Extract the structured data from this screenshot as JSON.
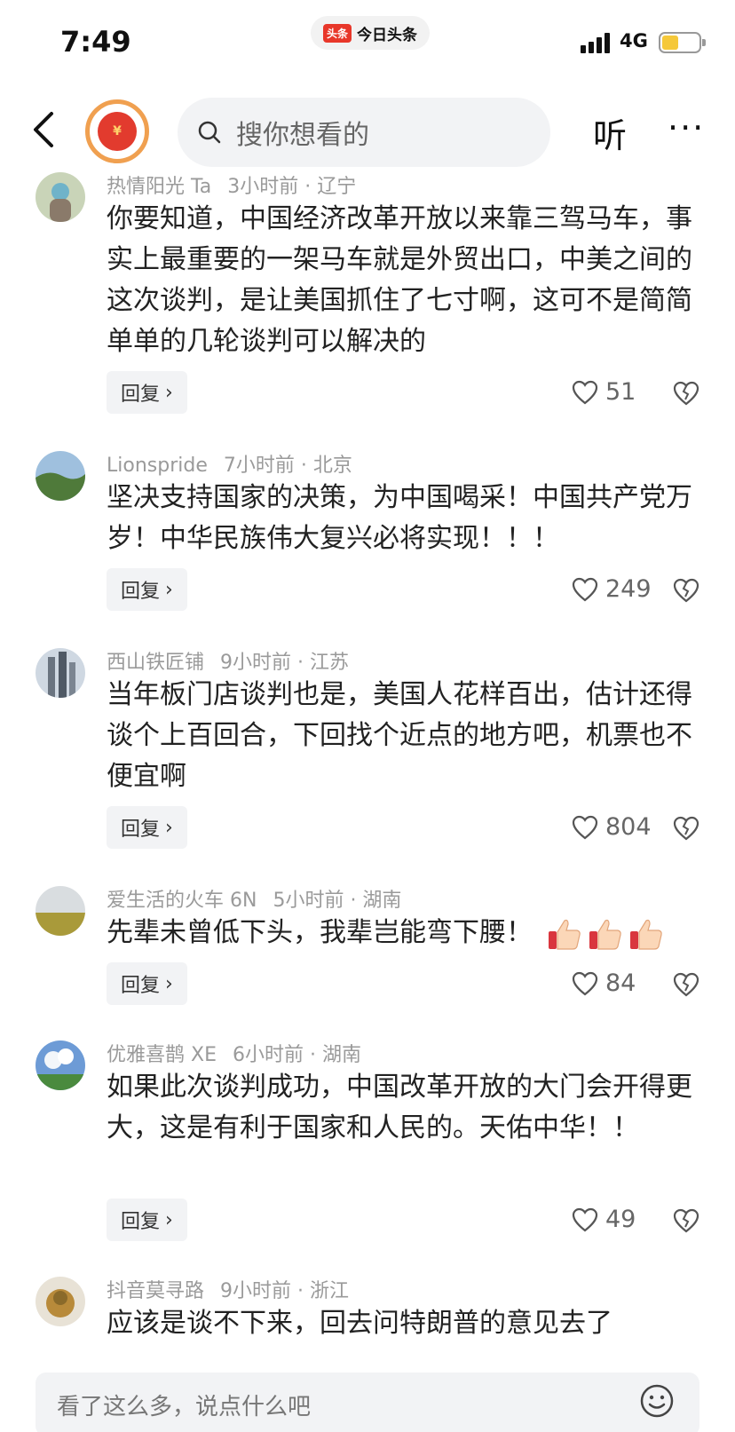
{
  "status_bar": {
    "time": "7:49",
    "app_logo": "头条",
    "app_name": "今日头条",
    "network": "4G",
    "battery_color": "#f5c83a"
  },
  "top_nav": {
    "back_icon": "chevron-left-icon",
    "avatar_icon": "red-envelope-icon",
    "avatar_glyph": "¥",
    "search_placeholder": "搜你想看的",
    "listen_label": "听",
    "more_label": "···"
  },
  "reply_label": "回复",
  "comments": [
    {
      "user": "热情阳光 Ta",
      "time_location": "3小时前 · 辽宁",
      "text": "你要知道，中国经济改革开放以来靠三驾马车，事实上最重要的一架马车就是外贸出口，中美之间的这次谈判，是让美国抓住了七寸啊，这可不是简简单单的几轮谈判可以解决的",
      "likes": "51"
    },
    {
      "user": "Lionspride",
      "time_location": "7小时前 · 北京",
      "text": "坚决支持国家的决策，为中国喝采！中国共产党万岁！中华民族伟大复兴必将实现！！！",
      "likes": "249"
    },
    {
      "user": "西山铁匠铺",
      "time_location": "9小时前 · 江苏",
      "text": "当年板门店谈判也是，美国人花样百出，估计还得谈个上百回合，下回找个近点的地方吧，机票也不便宜啊",
      "likes": "804"
    },
    {
      "user": "爱生活的火车 6N",
      "time_location": "5小时前 · 湖南",
      "text": "先辈未曾低下头，我辈岂能弯下腰！",
      "emoji": "thumbs-up-icon",
      "likes": "84"
    },
    {
      "user": "优雅喜鹊 XE",
      "time_location": "6小时前 · 湖南",
      "text": "如果此次谈判成功，中国改革开放的大门会开得更大，这是有利于国家和人民的。天佑中华！！",
      "likes": "49"
    },
    {
      "user": "抖音莫寻路",
      "time_location": "9小时前 · 浙江",
      "text": "应该是谈不下来，回去问特朗普的意见去了"
    }
  ],
  "bottom_bar": {
    "input_placeholder": "看了这么多，说点什么吧",
    "emoji_icon": "smiley-icon"
  }
}
